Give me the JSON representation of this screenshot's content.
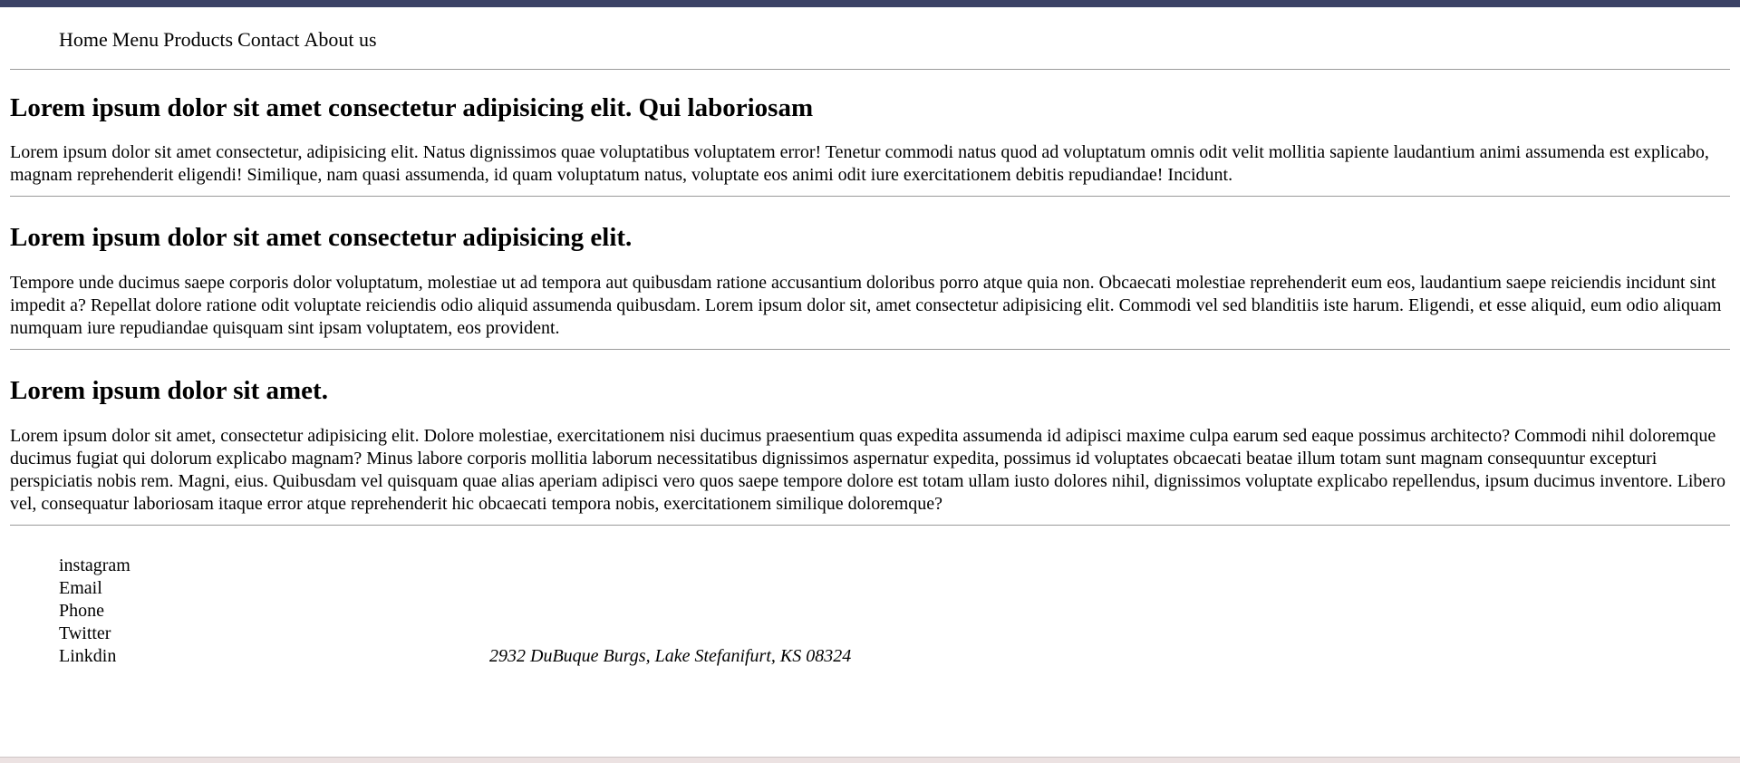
{
  "nav": {
    "items": [
      "Home",
      "Menu",
      "Products",
      "Contact",
      "About us"
    ]
  },
  "sections": [
    {
      "heading": "Lorem ipsum dolor sit amet consectetur adipisicing elit. Qui laboriosam",
      "body": "Lorem ipsum dolor sit amet consectetur, adipisicing elit. Natus dignissimos quae voluptatibus voluptatem error! Tenetur commodi natus quod ad voluptatum omnis odit velit mollitia sapiente laudantium animi assumenda est explicabo, magnam reprehenderit eligendi! Similique, nam quasi assumenda, id quam voluptatum natus, voluptate eos animi odit iure exercitationem debitis repudiandae! Incidunt."
    },
    {
      "heading": "Lorem ipsum dolor sit amet consectetur adipisicing elit.",
      "body": "Tempore unde ducimus saepe corporis dolor voluptatum, molestiae ut ad tempora aut quibusdam ratione accusantium doloribus porro atque quia non. Obcaecati molestiae reprehenderit eum eos, laudantium saepe reiciendis incidunt sint impedit a? Repellat dolore ratione odit voluptate reiciendis odio aliquid assumenda quibusdam. Lorem ipsum dolor sit, amet consectetur adipisicing elit. Commodi vel sed blanditiis iste harum. Eligendi, et esse aliquid, eum odio aliquam numquam iure repudiandae quisquam sint ipsam voluptatem, eos provident."
    },
    {
      "heading": "Lorem ipsum dolor sit amet.",
      "body": "Lorem ipsum dolor sit amet, consectetur adipisicing elit. Dolore molestiae, exercitationem nisi ducimus praesentium quas expedita assumenda id adipisci maxime culpa earum sed eaque possimus architecto? Commodi nihil doloremque ducimus fugiat qui dolorum explicabo magnam? Minus labore corporis mollitia laborum necessitatibus dignissimos aspernatur expedita, possimus id voluptates obcaecati beatae illum totam sunt magnam consequuntur excepturi perspiciatis nobis rem. Magni, eius. Quibusdam vel quisquam quae alias aperiam adipisci vero quos saepe tempore dolore est totam ullam iusto dolores nihil, dignissimos voluptate explicabo repellendus, ipsum ducimus inventore. Libero vel, consequatur laboriosam itaque error atque reprehenderit hic obcaecati tempora nobis, exercitationem similique doloremque?"
    }
  ],
  "footer": {
    "links": [
      "instagram",
      "Email",
      "Phone",
      "Twitter",
      "Linkdin"
    ],
    "address": "2932 DuBuque Burgs, Lake Stefanifurt, KS 08324"
  },
  "colors": {
    "top_bar": "#3b4266",
    "divider": "#9a9a9a",
    "bottom_strip": "#ece2e2"
  }
}
